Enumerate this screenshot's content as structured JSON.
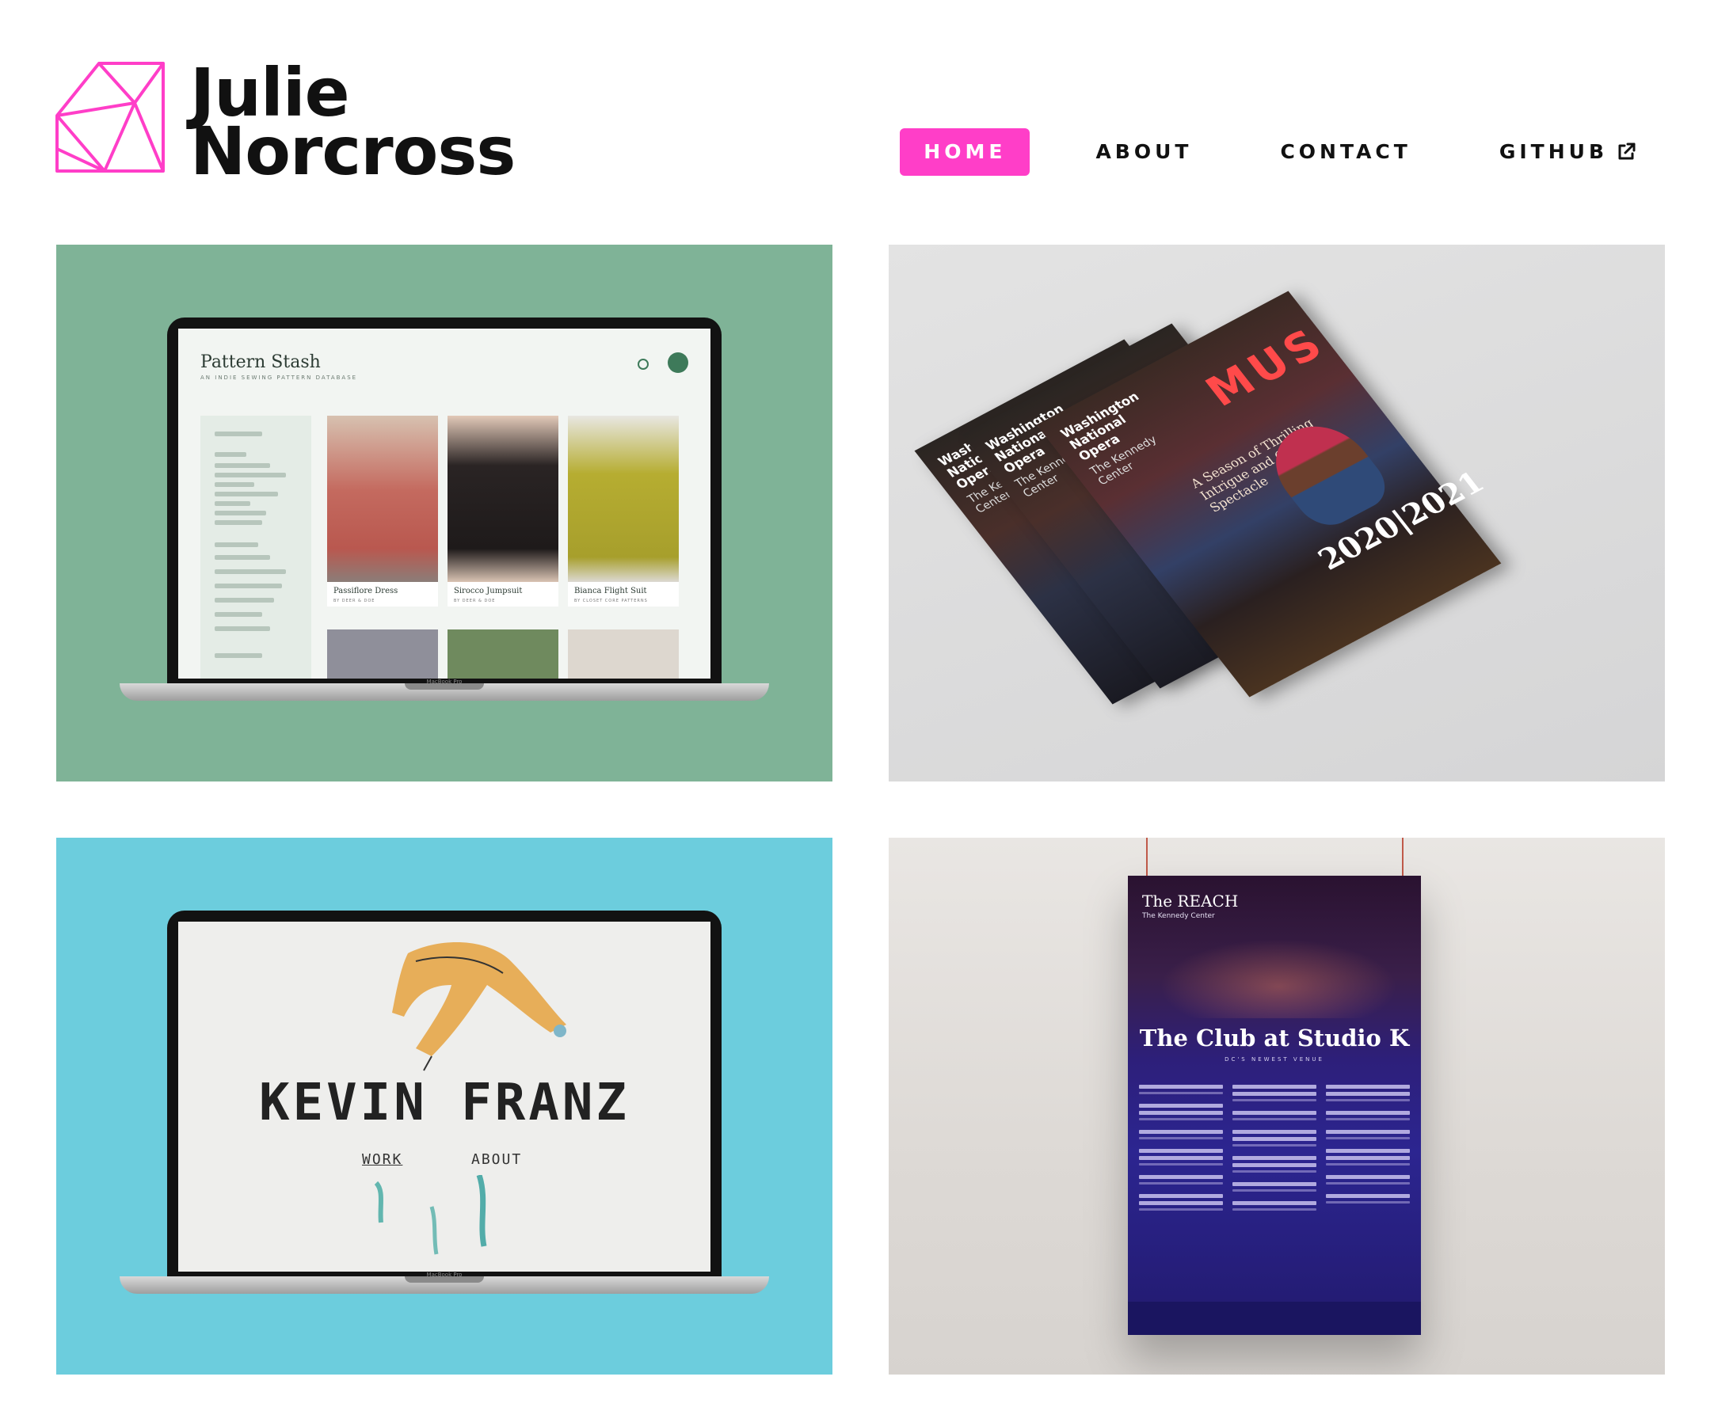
{
  "brand": {
    "first_name": "Julie",
    "last_name": "Norcross",
    "accent_color": "#ff3ec8",
    "logo_icon": "gem-icon"
  },
  "nav": {
    "items": [
      {
        "label": "HOME",
        "active": true
      },
      {
        "label": "ABOUT",
        "active": false
      },
      {
        "label": "CONTACT",
        "active": false
      },
      {
        "label": "GITHUB",
        "active": false,
        "icon": "external-link-icon"
      }
    ]
  },
  "projects": {
    "pattern_stash": {
      "title": "Pattern Stash",
      "subtitle": "AN INDIE SEWING PATTERN DATABASE",
      "cards": [
        {
          "name": "Passiflore Dress",
          "by": "BY DEER & DOE"
        },
        {
          "name": "Sirocco Jumpsuit",
          "by": "BY DEER & DOE"
        },
        {
          "name": "Bianca Flight Suit",
          "by": "BY CLOSET CORE PATTERNS"
        }
      ],
      "laptop_label": "MacBook Pro"
    },
    "opera": {
      "org": "Washington National Opera",
      "venue": "The Kennedy Center",
      "season": "2020|2021",
      "tagline": "A Season of Thrilling Intrigue and Grand Spectacle",
      "sign": "MUS"
    },
    "kevin_franz": {
      "title": "KEVIN FRANZ",
      "link_work": "WORK",
      "link_about": "ABOUT",
      "laptop_label": "MacBook Pro"
    },
    "reach": {
      "header": "The REACH",
      "kennedy": "The Kennedy Center",
      "title": "The Club at Studio K",
      "subtitle": "DC'S NEWEST VENUE"
    }
  }
}
